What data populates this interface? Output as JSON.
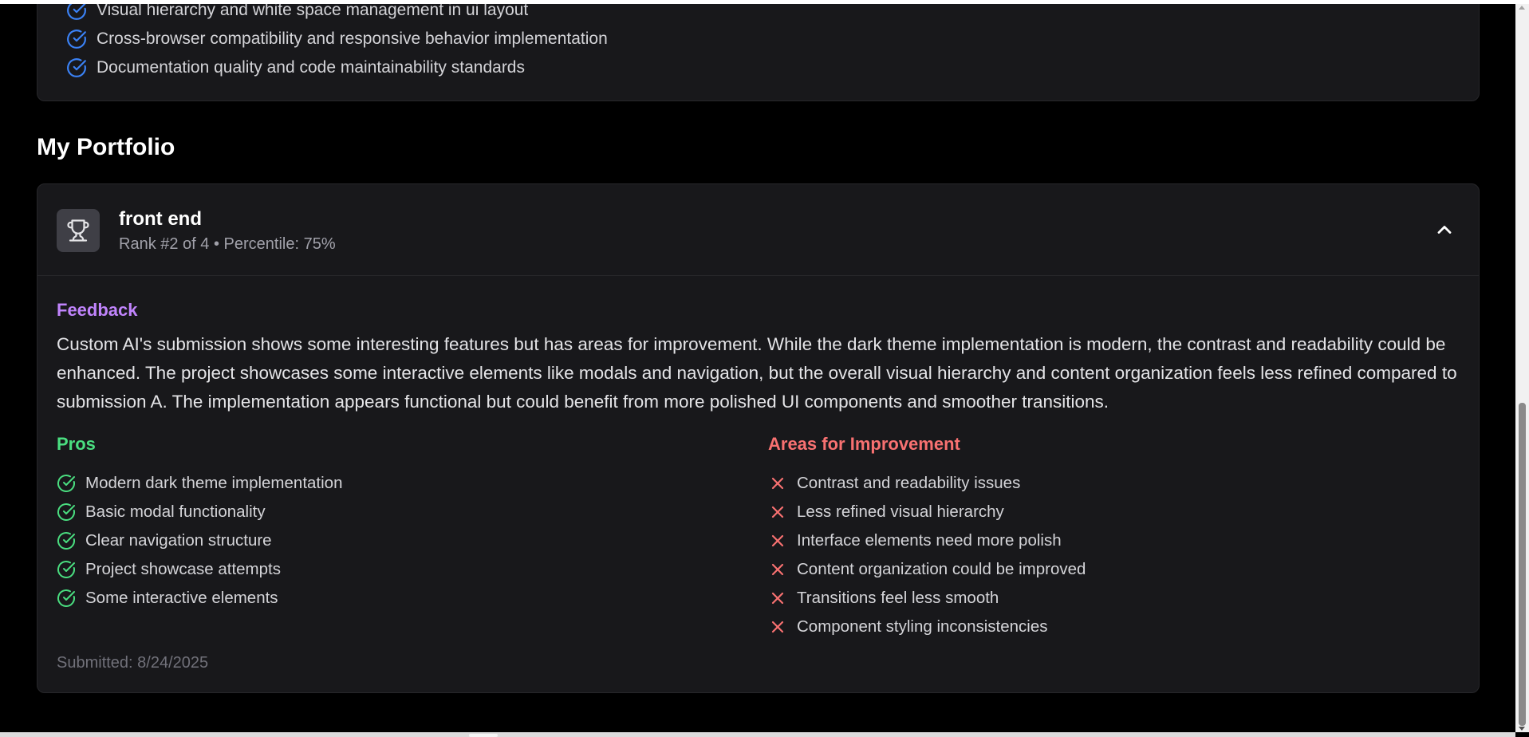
{
  "previous_card": {
    "criteria": [
      "Visual hierarchy and white space management in ui layout",
      "Cross-browser compatibility and responsive behavior implementation",
      "Documentation quality and code maintainability standards"
    ]
  },
  "portfolio": {
    "section_title": "My Portfolio",
    "entry": {
      "icon": "trophy-icon",
      "title": "front end",
      "meta": "Rank #2 of 4 • Percentile: 75%",
      "expanded": true,
      "feedback_label": "Feedback",
      "feedback_text": "Custom AI's submission shows some interesting features but has areas for improvement. While the dark theme implementation is modern, the contrast and readability could be enhanced. The project showcases some interactive elements like modals and navigation, but the overall visual hierarchy and content organization feels less refined compared to submission A. The implementation appears functional but could benefit from more polished UI components and smoother transitions.",
      "pros_title": "Pros",
      "pros": [
        "Modern dark theme implementation",
        "Basic modal functionality",
        "Clear navigation structure",
        "Project showcase attempts",
        "Some interactive elements"
      ],
      "cons_title": "Areas for Improvement",
      "cons": [
        "Contrast and readability issues",
        "Less refined visual hierarchy",
        "Interface elements need more polish",
        "Content organization could be improved",
        "Transitions feel less smooth",
        "Component styling inconsistencies"
      ],
      "submitted": "Submitted: 8/24/2025"
    }
  },
  "colors": {
    "background": "#000000",
    "card": "#18181b",
    "feedback_accent": "#c084fc",
    "pros_accent": "#4ade80",
    "cons_accent": "#f87171",
    "criteria_check": "#3b82f6"
  }
}
